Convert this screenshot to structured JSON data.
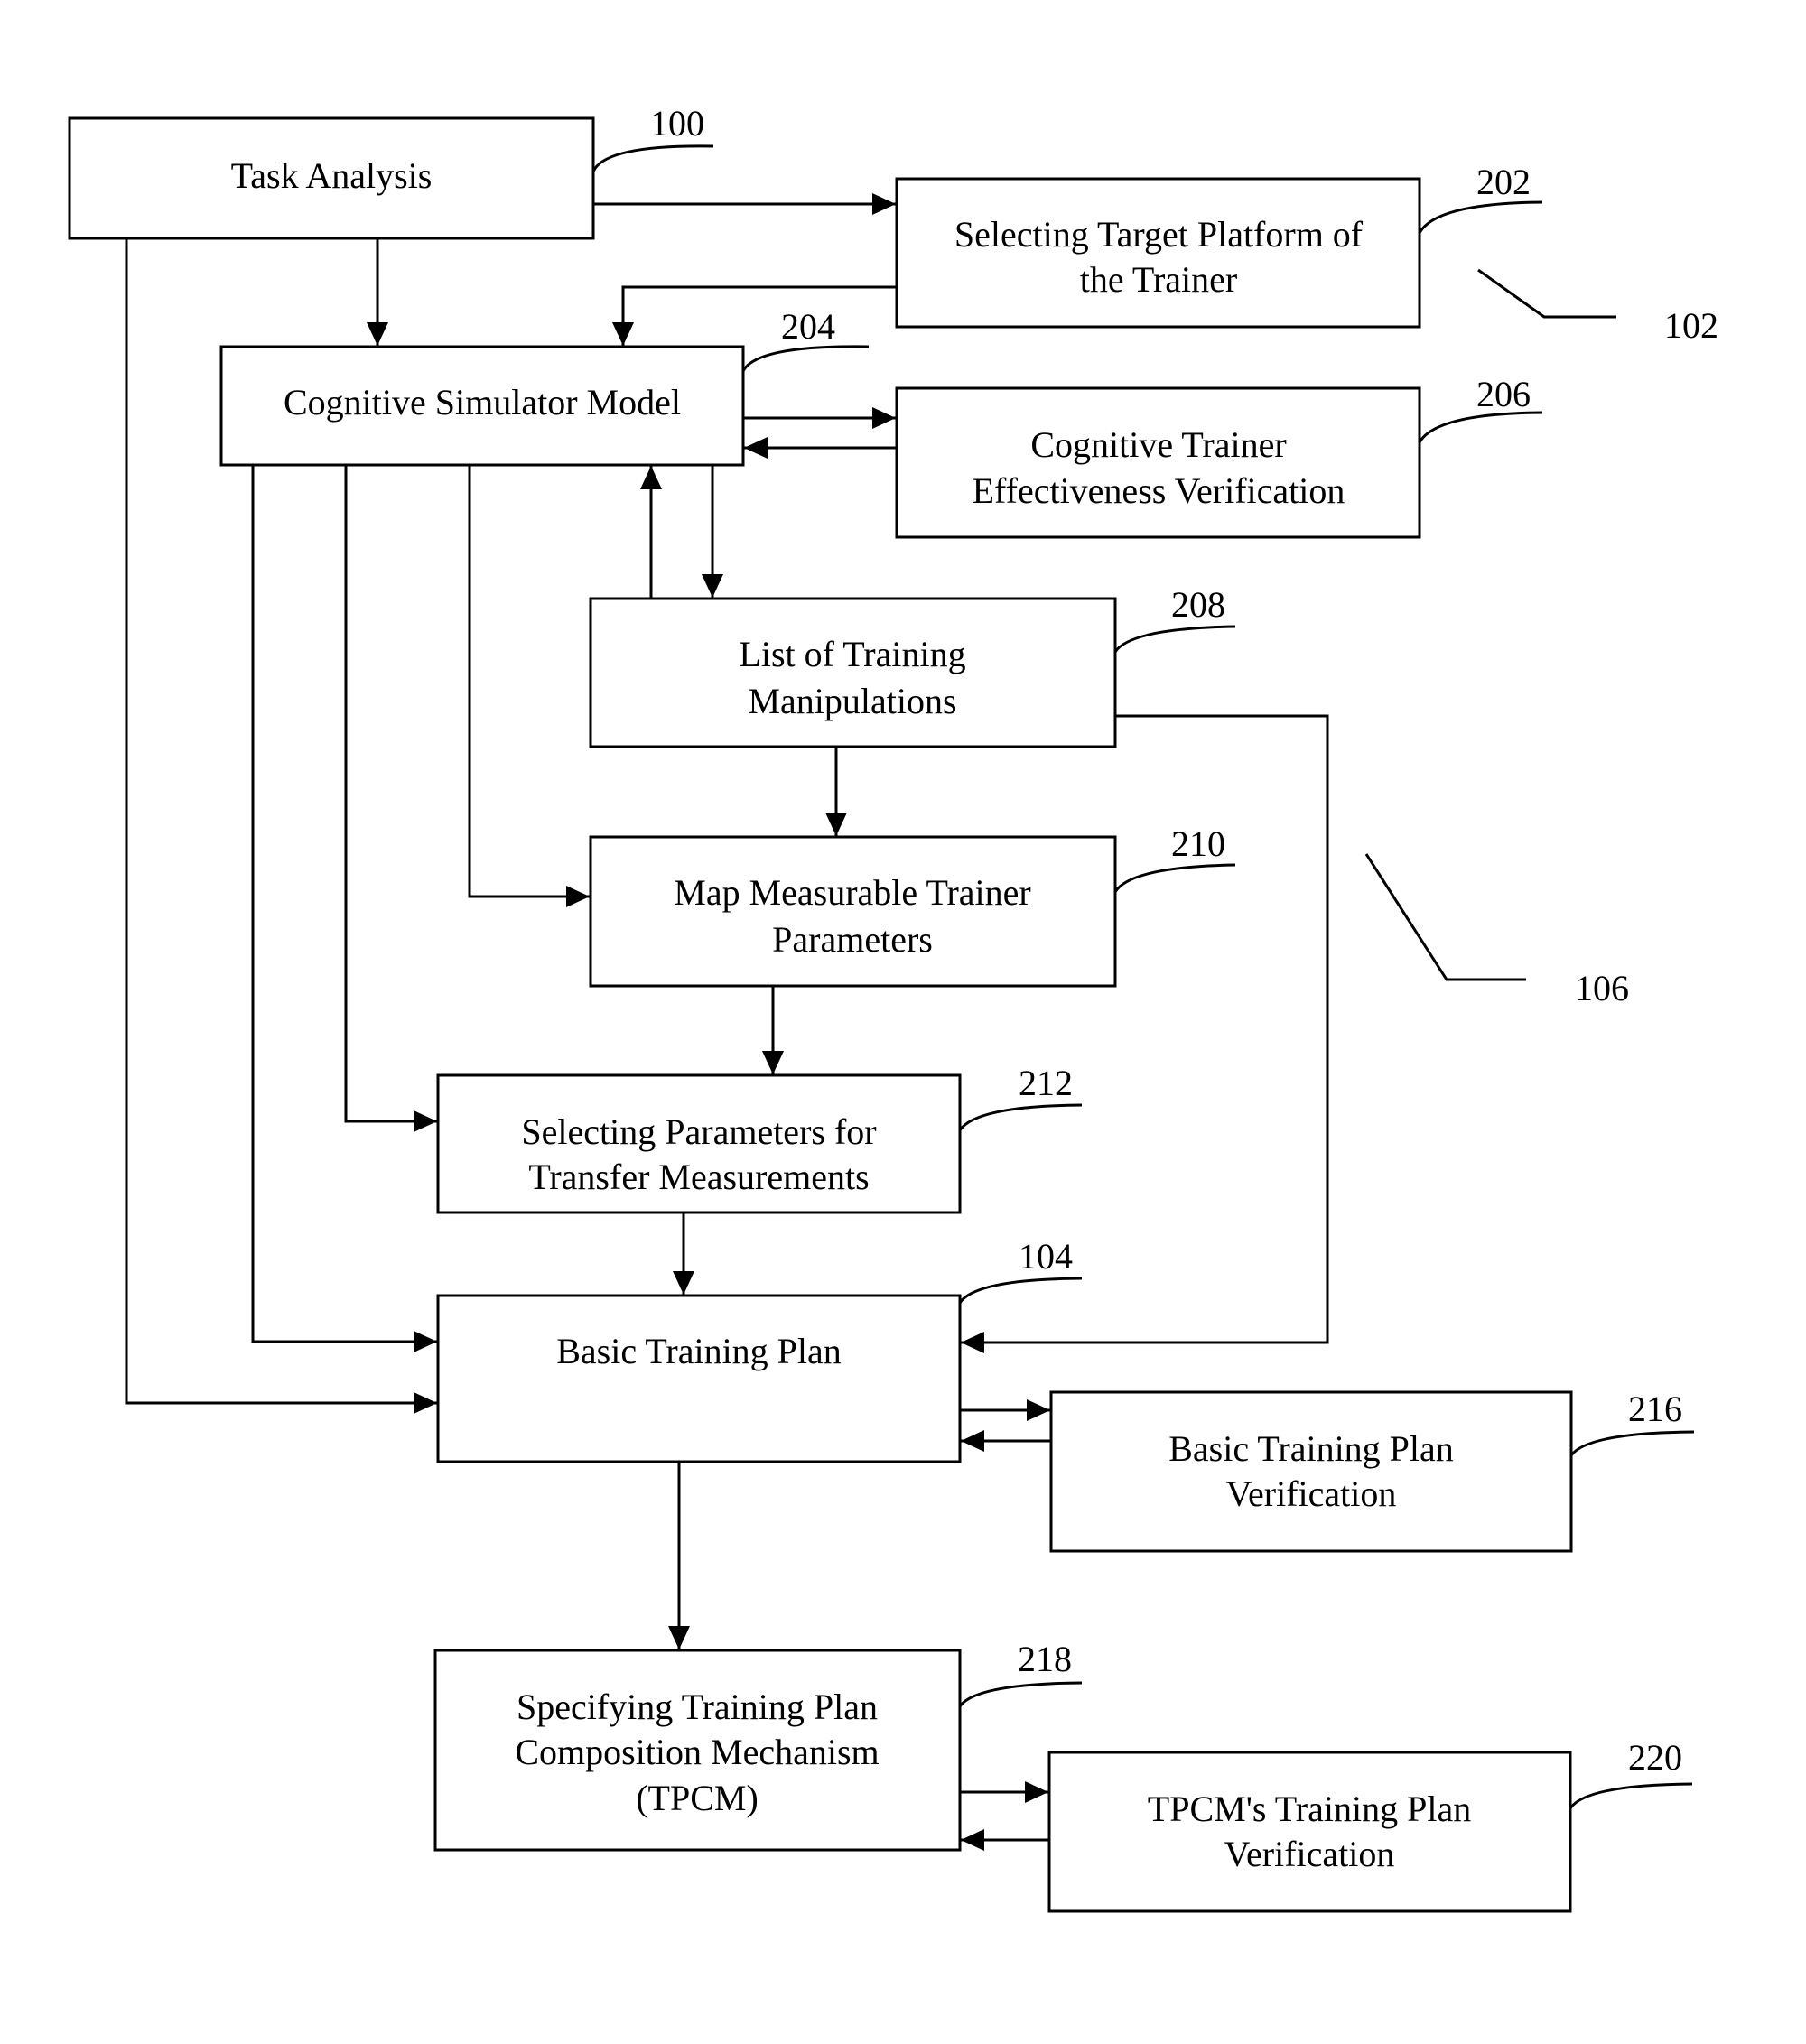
{
  "diagram": {
    "type": "flowchart",
    "nodes": [
      {
        "id": "task",
        "ref": "100",
        "lines": [
          "Task Analysis"
        ]
      },
      {
        "id": "platform",
        "ref": "202",
        "lines": [
          "Selecting Target Platform of",
          "the Trainer"
        ]
      },
      {
        "id": "csm",
        "ref": "204",
        "lines": [
          "Cognitive Simulator Model"
        ]
      },
      {
        "id": "ctev",
        "ref": "206",
        "lines": [
          "Cognitive Trainer",
          "Effectiveness Verification"
        ]
      },
      {
        "id": "ltm",
        "ref": "208",
        "lines": [
          "List of Training",
          "Manipulations"
        ]
      },
      {
        "id": "mmtp",
        "ref": "210",
        "lines": [
          "Map Measurable Trainer",
          "Parameters"
        ]
      },
      {
        "id": "sptm",
        "ref": "212",
        "lines": [
          "Selecting Parameters for",
          "Transfer Measurements"
        ]
      },
      {
        "id": "btp",
        "ref": "104",
        "lines": [
          "Basic Training Plan"
        ]
      },
      {
        "id": "btpv",
        "ref": "216",
        "lines": [
          "Basic Training Plan",
          "Verification"
        ]
      },
      {
        "id": "tpcm",
        "ref": "218",
        "lines": [
          "Specifying Training Plan",
          "Composition Mechanism",
          "(TPCM)"
        ]
      },
      {
        "id": "tpcmv",
        "ref": "220",
        "lines": [
          "TPCM's Training Plan",
          "Verification"
        ]
      }
    ],
    "group_refs": [
      "102",
      "106"
    ],
    "edges": [
      [
        "task",
        "platform"
      ],
      [
        "task",
        "csm"
      ],
      [
        "task",
        "btp"
      ],
      [
        "platform",
        "csm"
      ],
      [
        "csm",
        "ctev"
      ],
      [
        "ctev",
        "csm"
      ],
      [
        "csm",
        "ltm"
      ],
      [
        "ltm",
        "csm"
      ],
      [
        "csm",
        "mmtp"
      ],
      [
        "csm",
        "sptm"
      ],
      [
        "csm",
        "btp"
      ],
      [
        "ltm",
        "mmtp"
      ],
      [
        "ltm",
        "btp"
      ],
      [
        "mmtp",
        "sptm"
      ],
      [
        "sptm",
        "btp"
      ],
      [
        "btp",
        "btpv"
      ],
      [
        "btpv",
        "btp"
      ],
      [
        "btp",
        "tpcm"
      ],
      [
        "tpcm",
        "tpcmv"
      ],
      [
        "tpcmv",
        "tpcm"
      ]
    ]
  }
}
